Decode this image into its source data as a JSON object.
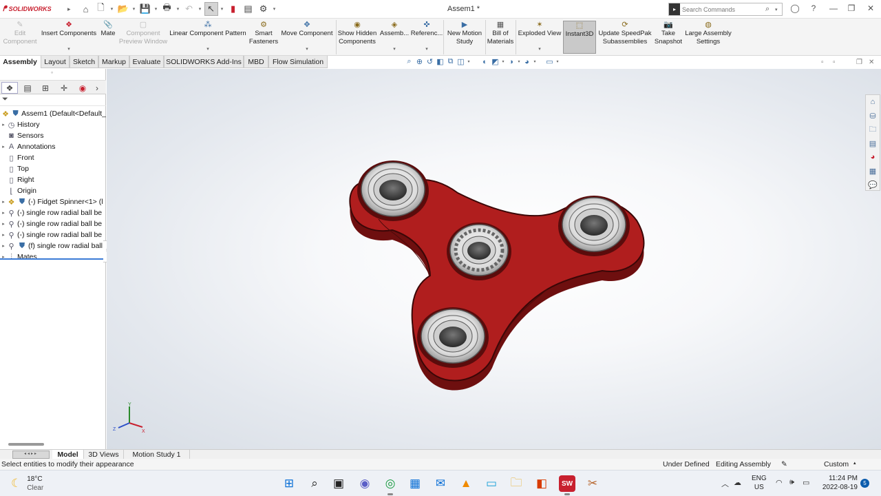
{
  "app": {
    "brand": "SOLIDWORKS",
    "window_title": "Assem1 *",
    "search_placeholder": "Search Commands"
  },
  "ribbon": {
    "buttons": [
      {
        "label1": "Edit",
        "label2": "Component",
        "icon": "edit-component-icon",
        "disabled": true
      },
      {
        "label1": "Insert Components",
        "label2": "",
        "icon": "insert-components-icon"
      },
      {
        "label1": "Mate",
        "label2": "",
        "icon": "mate-icon"
      },
      {
        "label1": "Component",
        "label2": "Preview Window",
        "icon": "preview-window-icon",
        "disabled": true
      },
      {
        "label1": "Linear Component Pattern",
        "label2": "",
        "icon": "linear-pattern-icon"
      },
      {
        "label1": "Smart",
        "label2": "Fasteners",
        "icon": "smart-fasteners-icon"
      },
      {
        "label1": "Move Component",
        "label2": "",
        "icon": "move-component-icon"
      },
      {
        "label1": "Show Hidden",
        "label2": "Components",
        "icon": "show-hidden-icon"
      },
      {
        "label1": "Assemb...",
        "label2": "",
        "icon": "assembly-features-icon"
      },
      {
        "label1": "Referenc...",
        "label2": "",
        "icon": "reference-geometry-icon"
      },
      {
        "label1": "New Motion",
        "label2": "Study",
        "icon": "motion-study-icon"
      },
      {
        "label1": "Bill of",
        "label2": "Materials",
        "icon": "bom-icon"
      },
      {
        "label1": "Exploded View",
        "label2": "",
        "icon": "exploded-view-icon"
      },
      {
        "label1": "Instant3D",
        "label2": "",
        "icon": "instant3d-icon",
        "active": true
      },
      {
        "label1": "Update SpeedPak",
        "label2": "Subassemblies",
        "icon": "speedpak-icon"
      },
      {
        "label1": "Take",
        "label2": "Snapshot",
        "icon": "snapshot-icon"
      },
      {
        "label1": "Large Assembly",
        "label2": "Settings",
        "icon": "large-assembly-icon"
      }
    ]
  },
  "tabs": [
    "Assembly",
    "Layout",
    "Sketch",
    "Markup",
    "Evaluate",
    "SOLIDWORKS Add-Ins",
    "MBD",
    "Flow Simulation"
  ],
  "tree": {
    "root": "Assem1  (Default<Default_",
    "items": [
      {
        "label": "History",
        "icon": "history-icon",
        "expand": true
      },
      {
        "label": "Sensors",
        "icon": "sensors-icon",
        "expand": false
      },
      {
        "label": "Annotations",
        "icon": "annotations-icon",
        "expand": true
      },
      {
        "label": "Front",
        "icon": "plane-icon",
        "expand": false
      },
      {
        "label": "Top",
        "icon": "plane-icon",
        "expand": false
      },
      {
        "label": "Right",
        "icon": "plane-icon",
        "expand": false
      },
      {
        "label": "Origin",
        "icon": "origin-icon",
        "expand": false
      },
      {
        "label": "(-) Fidget Spinner<1> (l",
        "icon": "part-icon",
        "expand": true
      },
      {
        "label": "(-) single row radial ball be",
        "icon": "subassembly-icon",
        "expand": true
      },
      {
        "label": "(-) single row radial ball be",
        "icon": "subassembly-icon",
        "expand": true
      },
      {
        "label": "(-) single row radial ball be",
        "icon": "subassembly-icon",
        "expand": true
      },
      {
        "label": "(f) single row radial ball",
        "icon": "subassembly-icon",
        "expand": true
      },
      {
        "label": "Mates",
        "icon": "mates-icon",
        "expand": true
      }
    ]
  },
  "triad": {
    "x": "X",
    "y": "Y",
    "z": "Z"
  },
  "bottom_tabs": [
    "Model",
    "3D Views",
    "Motion Study 1"
  ],
  "status": {
    "message": "Select entities to modify their appearance",
    "state": "Under Defined",
    "mode": "Editing Assembly",
    "units": "Custom"
  },
  "taskbar": {
    "temperature": "18°C",
    "condition": "Clear",
    "lang1": "ENG",
    "lang2": "US",
    "time": "11:24 PM",
    "date": "2022-08-19",
    "notifications": "5"
  },
  "colors": {
    "spinner_body": "#b01e1e",
    "brand_red": "#c8202f"
  }
}
